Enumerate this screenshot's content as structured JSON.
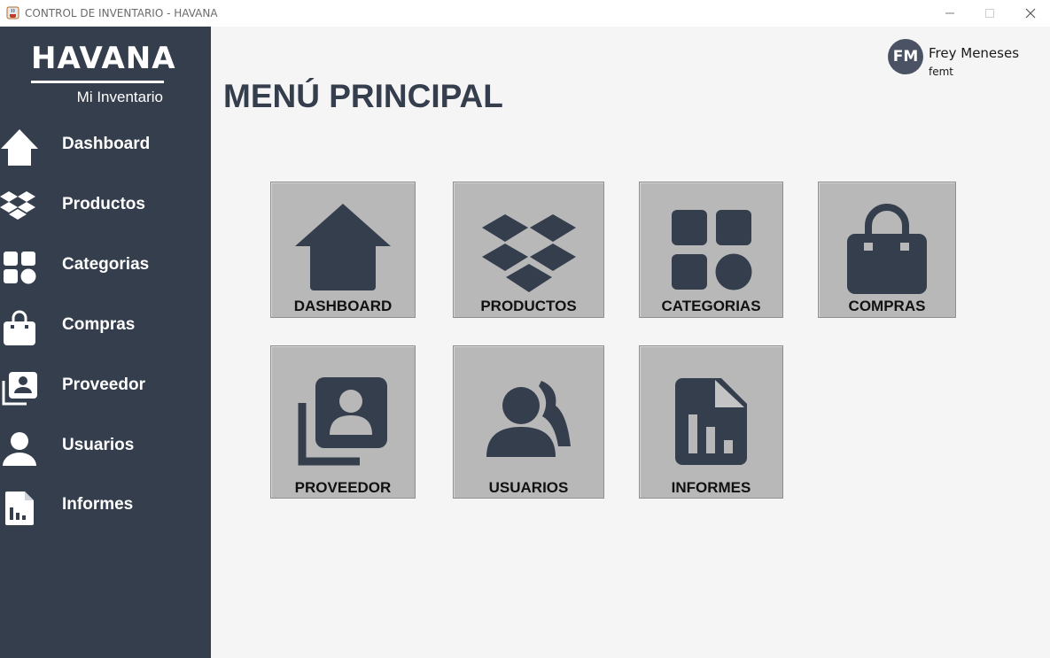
{
  "window": {
    "title": "CONTROL DE INVENTARIO - HAVANA",
    "minimize_icon": "minimize-icon",
    "maximize_icon": "maximize-icon",
    "close_icon": "close-icon"
  },
  "sidebar": {
    "brand": "HAVANA",
    "subtitle": "Mi Inventario",
    "background": "#353e4d",
    "items": [
      {
        "label": "Dashboard",
        "icon": "home-icon"
      },
      {
        "label": "Productos",
        "icon": "dropbox-icon"
      },
      {
        "label": "Categorias",
        "icon": "categories-icon"
      },
      {
        "label": "Compras",
        "icon": "shopping-bag-icon"
      },
      {
        "label": "Proveedor",
        "icon": "contacts-icon"
      },
      {
        "label": "Usuarios",
        "icon": "user-icon"
      },
      {
        "label": "Informes",
        "icon": "report-icon"
      }
    ]
  },
  "user": {
    "initials": "FM",
    "name": "Frey Meneses",
    "login": "femt"
  },
  "main": {
    "title": "MENÚ PRINCIPAL",
    "tiles": [
      {
        "label": "DASHBOARD",
        "icon": "home-icon"
      },
      {
        "label": "PRODUCTOS",
        "icon": "dropbox-icon"
      },
      {
        "label": "CATEGORIAS",
        "icon": "categories-icon"
      },
      {
        "label": "COMPRAS",
        "icon": "shopping-bag-icon"
      },
      {
        "label": "PROVEEDOR",
        "icon": "contacts-icon"
      },
      {
        "label": "USUARIOS",
        "icon": "users-icon"
      },
      {
        "label": "INFORMES",
        "icon": "report-icon"
      }
    ]
  },
  "colors": {
    "sidebar": "#353e4d",
    "tile": "#b8b8b8",
    "content_bg": "#f5f5f5"
  }
}
